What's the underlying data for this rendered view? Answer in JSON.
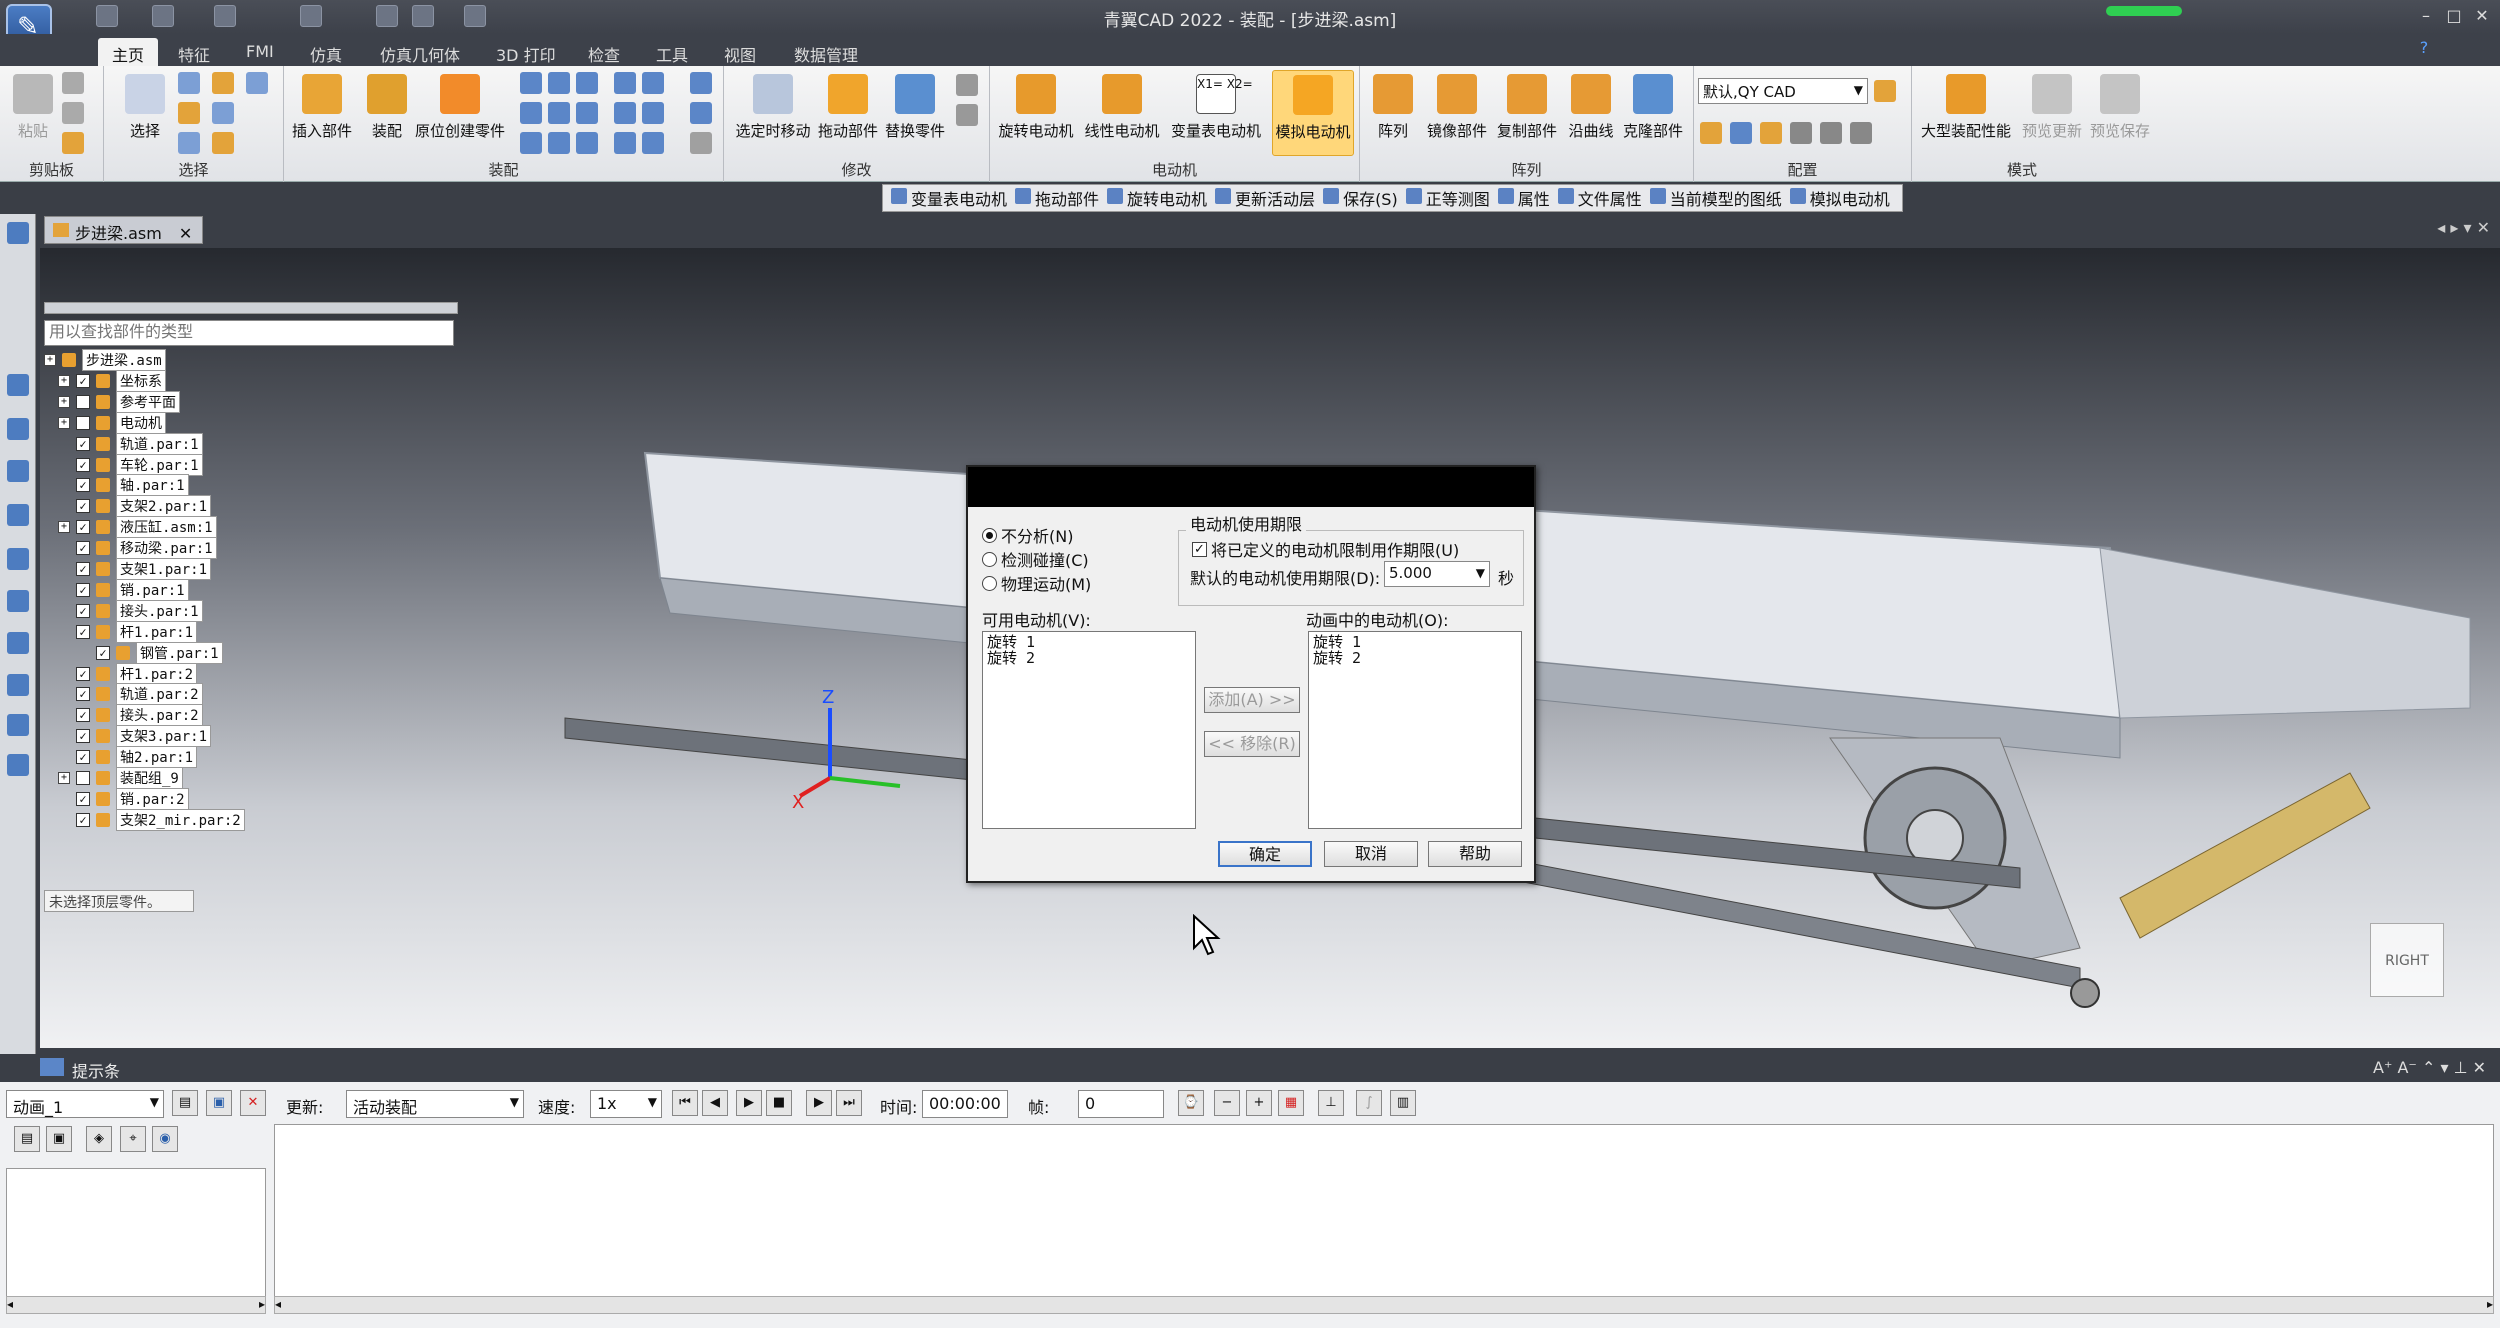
{
  "app": {
    "title": "青翼CAD 2022 - 装配 - [步进梁.asm]"
  },
  "ribbon_tabs": [
    "主页",
    "特征",
    "FMI",
    "仿真",
    "仿真几何体",
    "3D 打印",
    "检查",
    "工具",
    "视图",
    "数据管理"
  ],
  "ribbon": {
    "groups": {
      "clipboard": "剪贴板",
      "select": "选择",
      "assembly": "装配",
      "modify": "修改",
      "motor": "电动机",
      "pattern": "阵列",
      "config": "配置",
      "mode": "模式"
    },
    "buttons": {
      "paste": "粘贴",
      "select": "选择",
      "insert_part": "插入部件",
      "assemble": "装配",
      "create_inplace": "原位创建零件",
      "select_move": "选定时移动",
      "drag_part": "拖动部件",
      "replace_part": "替换零件",
      "rot_motor": "旋转电动机",
      "lin_motor": "线性电动机",
      "var_motor": "变量表电动机",
      "sim_motor": "模拟电动机",
      "array": "阵列",
      "mirror": "镜像部件",
      "copy": "复制部件",
      "along_curve": "沿曲线",
      "clone": "克隆部件",
      "large_asm": "大型装配性能",
      "preview_update": "预览更新",
      "preview_save": "预览保存"
    },
    "config_select": "默认,QY CAD",
    "var_table_icon": "X1= X2="
  },
  "command_bar": [
    "变量表电动机",
    "拖动部件",
    "旋转电动机",
    "更新活动层",
    "保存(S)",
    "正等测图",
    "属性",
    "文件属性",
    "当前模型的图纸",
    "模拟电动机"
  ],
  "document_tab": "步进梁.asm",
  "pathfinder": {
    "search_placeholder": "用以查找部件的类型",
    "status_note": "未选择顶层零件。",
    "items": [
      {
        "label": "步进梁.asm",
        "level": 0,
        "check": false
      },
      {
        "label": "坐标系",
        "level": 1,
        "check": true
      },
      {
        "label": "参考平面",
        "level": 1,
        "check": false
      },
      {
        "label": "电动机",
        "level": 1,
        "check": false
      },
      {
        "label": "轨道.par:1",
        "level": 1,
        "check": true
      },
      {
        "label": "车轮.par:1",
        "level": 1,
        "check": true
      },
      {
        "label": "轴.par:1",
        "level": 1,
        "check": true
      },
      {
        "label": "支架2.par:1",
        "level": 1,
        "check": true
      },
      {
        "label": "液压缸.asm:1",
        "level": 1,
        "check": true
      },
      {
        "label": "移动梁.par:1",
        "level": 1,
        "check": true
      },
      {
        "label": "支架1.par:1",
        "level": 1,
        "check": true
      },
      {
        "label": "销.par:1",
        "level": 1,
        "check": true
      },
      {
        "label": "接头.par:1",
        "level": 1,
        "check": true
      },
      {
        "label": "杆1.par:1",
        "level": 1,
        "check": true
      },
      {
        "label": "钢管.par:1",
        "level": 2,
        "check": true
      },
      {
        "label": "杆1.par:2",
        "level": 1,
        "check": true
      },
      {
        "label": "轨道.par:2",
        "level": 1,
        "check": true
      },
      {
        "label": "接头.par:2",
        "level": 1,
        "check": true
      },
      {
        "label": "支架3.par:1",
        "level": 1,
        "check": true
      },
      {
        "label": "轴2.par:1",
        "level": 1,
        "check": true
      },
      {
        "label": "装配组_9",
        "level": 1,
        "check": false
      },
      {
        "label": "销.par:2",
        "level": 1,
        "check": true
      },
      {
        "label": "支架2_mir.par:2",
        "level": 1,
        "check": true
      }
    ]
  },
  "viewport": {
    "axis_z": "Z",
    "axis_x": "X",
    "view_cube": "RIGHT"
  },
  "dialog": {
    "options": [
      "不分析(N)",
      "检测碰撞(C)",
      "物理运动(M)"
    ],
    "selected_option": 0,
    "limit_group": "电动机使用期限",
    "use_defined_limit": "将已定义的电动机限制用作期限(U)",
    "default_limit_label": "默认的电动机使用期限(D):",
    "default_limit_value": "5.000",
    "unit": "秒",
    "available_label": "可用电动机(V):",
    "in_anim_label": "动画中的电动机(O):",
    "available": [
      "旋转 1",
      "旋转 2"
    ],
    "in_anim": [
      "旋转 1",
      "旋转 2"
    ],
    "add": "添加(A) >>",
    "remove": "<< 移除(R)",
    "ok": "确定",
    "cancel": "取消",
    "help": "帮助"
  },
  "bottom": {
    "title": "提示条",
    "animation": "动画_1",
    "update_label": "更新:",
    "update_value": "活动装配",
    "speed_label": "速度:",
    "speed_value": "1x",
    "time_label": "时间:",
    "time_value": "00:00:00",
    "frame_label": "帧:",
    "frame_value": "0"
  }
}
